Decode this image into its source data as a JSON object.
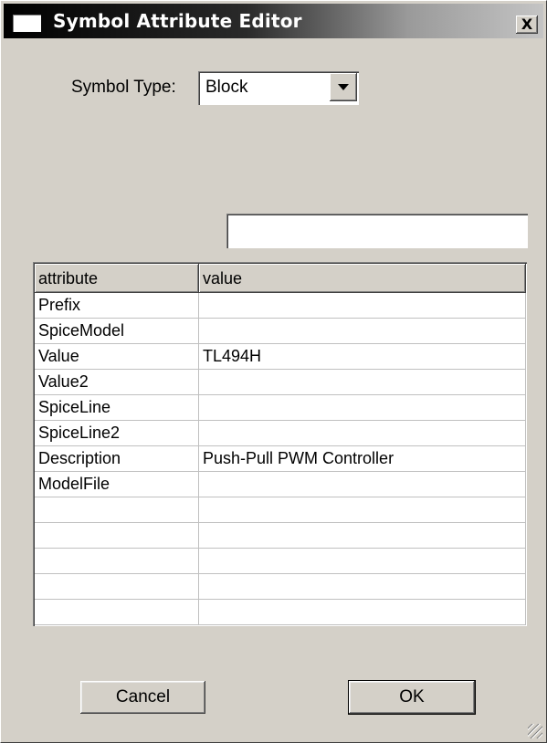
{
  "window": {
    "title": "Symbol Attribute Editor",
    "close_glyph": "X"
  },
  "symbol_type": {
    "label": "Symbol Type:",
    "selected": "Block"
  },
  "search": {
    "value": ""
  },
  "table": {
    "columns": [
      "attribute",
      "value"
    ],
    "rows": [
      [
        "Prefix",
        ""
      ],
      [
        "SpiceModel",
        ""
      ],
      [
        "Value",
        "TL494H"
      ],
      [
        "Value2",
        ""
      ],
      [
        "SpiceLine",
        ""
      ],
      [
        "SpiceLine2",
        ""
      ],
      [
        "Description",
        "Push-Pull PWM Controller"
      ],
      [
        "ModelFile",
        ""
      ],
      [
        "",
        ""
      ],
      [
        "",
        ""
      ],
      [
        "",
        ""
      ],
      [
        "",
        ""
      ],
      [
        "",
        ""
      ]
    ]
  },
  "buttons": {
    "cancel": "Cancel",
    "ok": "OK"
  },
  "colors": {
    "dialog_bg": "#d4d0c8",
    "titlebar_start": "#000000",
    "titlebar_end": "#c4c4c4"
  }
}
